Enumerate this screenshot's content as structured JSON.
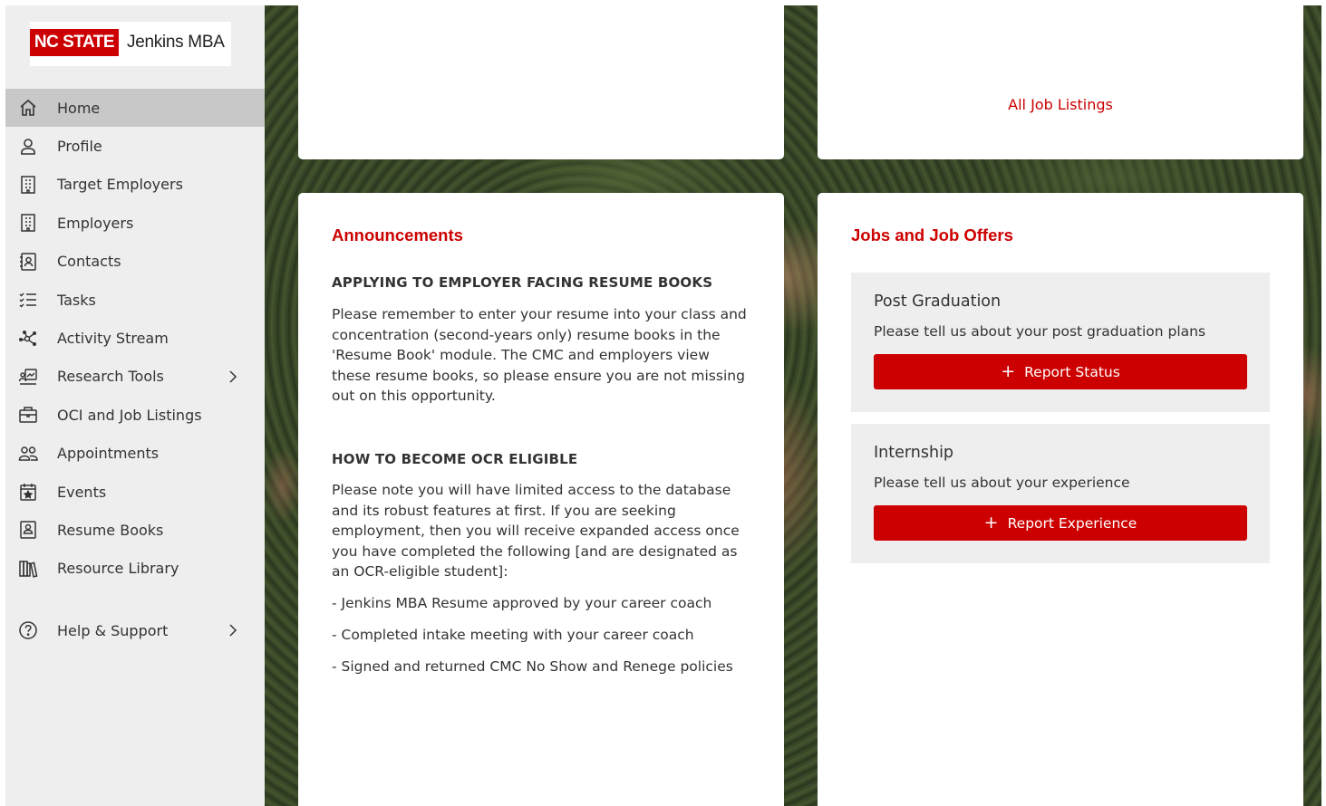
{
  "logo": {
    "red_text": "NC STATE",
    "side_text": "Jenkins MBA"
  },
  "sidebar": {
    "items": [
      {
        "label": "Home",
        "icon": "home-icon"
      },
      {
        "label": "Profile",
        "icon": "user-icon"
      },
      {
        "label": "Target Employers",
        "icon": "building-icon"
      },
      {
        "label": "Employers",
        "icon": "building-icon"
      },
      {
        "label": "Contacts",
        "icon": "contact-card-icon"
      },
      {
        "label": "Tasks",
        "icon": "task-list-icon"
      },
      {
        "label": "Activity Stream",
        "icon": "network-icon"
      },
      {
        "label": "Research Tools",
        "icon": "research-icon"
      },
      {
        "label": "OCI and Job Listings",
        "icon": "briefcase-icon"
      },
      {
        "label": "Appointments",
        "icon": "people-icon"
      },
      {
        "label": "Events",
        "icon": "calendar-star-icon"
      },
      {
        "label": "Resume Books",
        "icon": "resume-book-icon"
      },
      {
        "label": "Resource Library",
        "icon": "library-icon"
      }
    ],
    "help": {
      "label": "Help & Support",
      "icon": "help-circle-icon"
    }
  },
  "top_right_card": {
    "link": "All Job Listings"
  },
  "announcements": {
    "title": "Announcements",
    "heading1": "APPLYING TO EMPLOYER FACING RESUME BOOKS",
    "para1": "Please remember to enter your resume into your class and concentration (second-years only) resume books in the 'Resume Book' module. The CMC and employers view these resume books, so please ensure you are not missing out on this opportunity.",
    "heading2": "HOW TO BECOME OCR ELIGIBLE",
    "para2": "Please note you will have limited access to the database and its robust features at first.  If you are seeking employment, then you will receive expanded access once you have completed the following [and are designated as an OCR-eligible student]:",
    "bullets": [
      "- Jenkins MBA Resume approved by your career coach",
      "- Completed intake meeting with your career coach",
      "- Signed and returned CMC No Show and Renege policies"
    ]
  },
  "jobs": {
    "title": "Jobs and Job Offers",
    "post_grad": {
      "title": "Post Graduation",
      "text": "Please tell us about your post graduation plans",
      "button": "Report Status"
    },
    "internship": {
      "title": "Internship",
      "text": "Please tell us about your experience",
      "button": "Report Experience"
    }
  },
  "colors": {
    "accent": "#cc0000",
    "sidebar_bg": "#eeeeee",
    "active_bg": "#c8c8c8"
  }
}
